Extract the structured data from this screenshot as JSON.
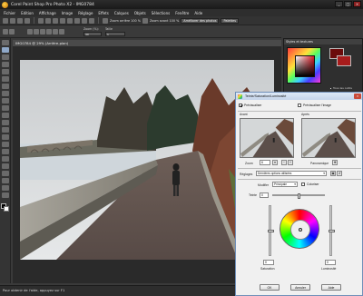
{
  "app": {
    "title": "Corel Paint Shop Pro Photo X2 - IMG0784",
    "window_buttons": {
      "min": "_",
      "max": "□",
      "close": "×"
    }
  },
  "menu": [
    "Fichier",
    "Edition",
    "Affichage",
    "Image",
    "Réglage",
    "Effets",
    "Calques",
    "Objets",
    "Sélections",
    "Fenêtre",
    "Aide"
  ],
  "toolbar": {
    "zoom_out_label": "Zoom arrière 100 %",
    "zoom_in_label": "Zoom avant 100 %",
    "enhance_combo": "Améliorer des photos",
    "palettes_combo": "Palettes"
  },
  "options_bar": {
    "zoom_title": "Zoom (%):",
    "zoom_value": "40",
    "zoom_more_title": "Zoom plus/moins",
    "mode_title": "Taille",
    "mode_value": "1"
  },
  "document": {
    "title": "IMG0784 @ 29% (Arrière-plan)"
  },
  "palette": {
    "title": "Styles et textures",
    "all_tools_label": "Tous les outils",
    "colors": {
      "foreground": "#6b0b0b",
      "background": "#a81c1c"
    }
  },
  "status_bar": {
    "text": "Pour obtenir de l'aide, appuyez sur F1"
  },
  "dialog": {
    "title": "Teinte/Saturation/Luminosité",
    "preview_on_image_label": "Prévisualiser",
    "preview_on_image2_label": "Prévisualiser l'image",
    "before_label": "Avant",
    "after_label": "Après",
    "zoom_label": "Zoom",
    "zoom_value": "6",
    "pan_label": "Panoramique",
    "settings_label": "Réglages",
    "settings_value": "Dernières options utilisées",
    "edit_label": "Modifier",
    "edit_value": "Principale",
    "colorize_label": "Coloriser",
    "hue_label": "Teinte",
    "hue_value": "0",
    "saturation_label": "Saturation",
    "saturation_value": "0",
    "lightness_label": "Luminosité",
    "lightness_value": "0",
    "ok_label": "OK",
    "cancel_label": "Annuler",
    "help_label": "Aide"
  }
}
